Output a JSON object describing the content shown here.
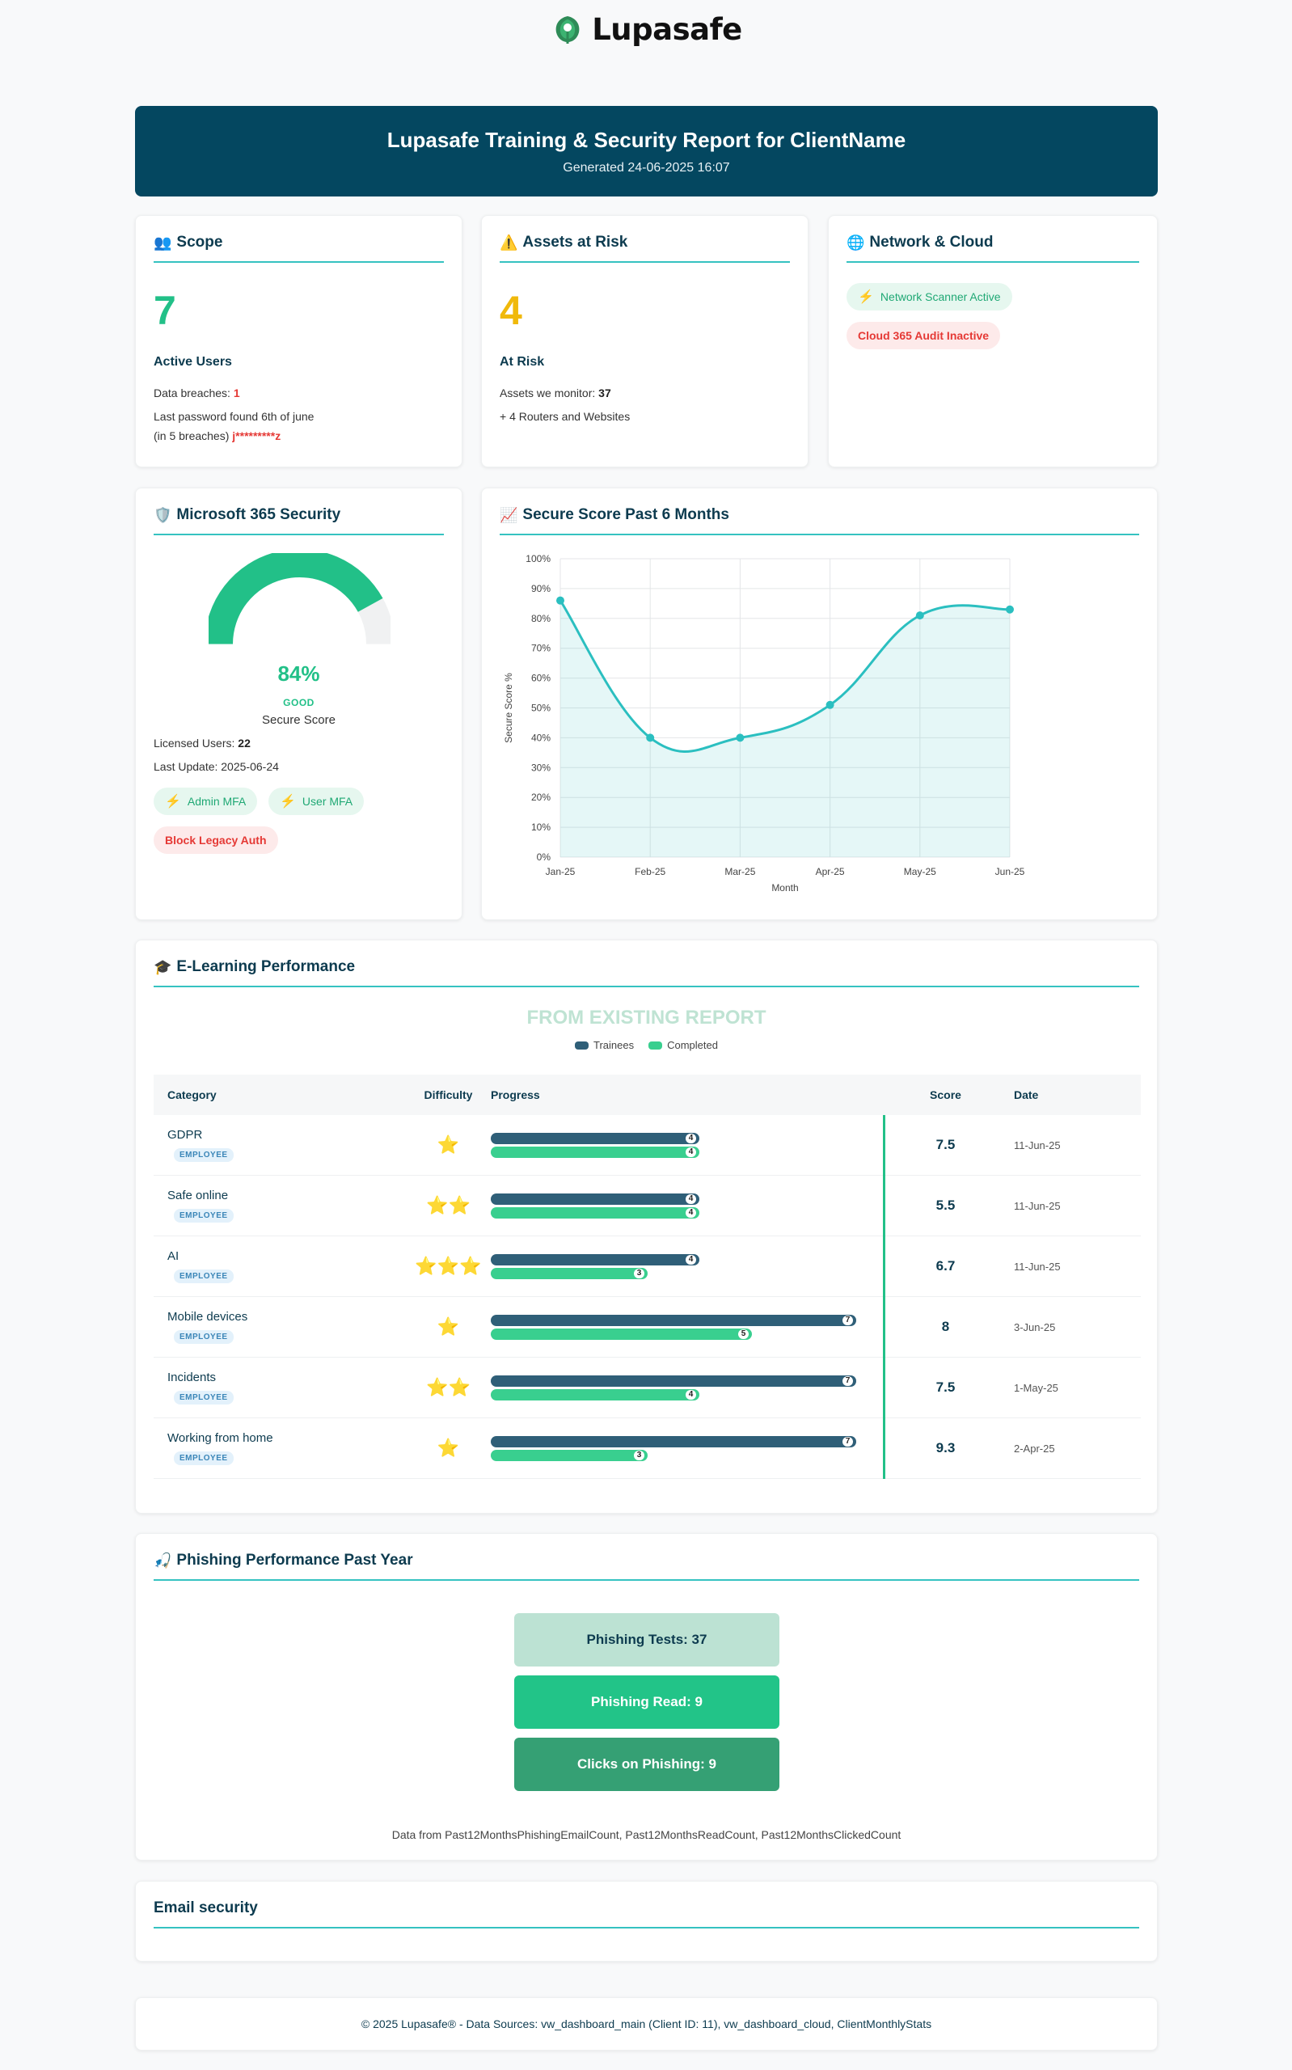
{
  "brand": {
    "name": "Lupasafe"
  },
  "header": {
    "title": "Lupasafe Training & Security Report for ClientName",
    "generated": "Generated 24-06-2025 16:07"
  },
  "scope": {
    "icon": "👥",
    "title": "Scope",
    "count": "7",
    "label": "Active Users",
    "breaches_label": "Data breaches: ",
    "breaches_value": "1",
    "last_password": "Last password found 6th of june",
    "breach_count_text": "(in 5 breaches) ",
    "masked_password": "j*********z"
  },
  "assets": {
    "icon": "⚠️",
    "title": "Assets at Risk",
    "count": "4",
    "label": "At Risk",
    "monitor_label": "Assets we monitor: ",
    "monitor_value": "37",
    "extra": "+ 4 Routers and Websites"
  },
  "network": {
    "icon": "🌐",
    "title": "Network & Cloud",
    "scanner": "Network Scanner Active",
    "cloud": "Cloud 365 Audit Inactive"
  },
  "m365": {
    "icon": "🛡️",
    "title": "Microsoft 365 Security",
    "score_pct": "84%",
    "score_value": 0.84,
    "rating": "GOOD",
    "score_label": "Secure Score",
    "licensed_label": "Licensed Users: ",
    "licensed_value": "22",
    "last_update": "Last Update: 2025-06-24",
    "admin_mfa": "Admin MFA",
    "user_mfa": "User MFA",
    "legacy": "Block Legacy Auth"
  },
  "secure_score": {
    "icon": "📈",
    "title": "Secure Score Past 6 Months"
  },
  "chart_data": {
    "type": "area",
    "categories": [
      "Jan-25",
      "Feb-25",
      "Mar-25",
      "Apr-25",
      "May-25",
      "Jun-25"
    ],
    "values": [
      86,
      40,
      40,
      51,
      81,
      83
    ],
    "xlabel": "Month",
    "ylabel": "Secure Score %",
    "ylim": [
      0,
      100
    ],
    "y_ticks": [
      "0%",
      "10%",
      "20%",
      "30%",
      "40%",
      "50%",
      "60%",
      "70%",
      "80%",
      "90%",
      "100%"
    ],
    "grid": true,
    "color": "#2bbfc0"
  },
  "elearning": {
    "icon": "🎓",
    "title": "E-Learning Performance",
    "watermark": "FROM EXISTING REPORT",
    "legend_trainees": "Trainees",
    "legend_completed": "Completed",
    "columns": [
      "Category",
      "Difficulty",
      "Progress",
      "Score",
      "Date"
    ],
    "max_trainees": 7,
    "rows": [
      {
        "category": "GDPR",
        "badge": "EMPLOYEE",
        "stars": "⭐",
        "trainees": 4,
        "completed": 4,
        "score": "7.5",
        "date": "11-Jun-25"
      },
      {
        "category": "Safe online",
        "badge": "EMPLOYEE",
        "stars": "⭐⭐",
        "trainees": 4,
        "completed": 4,
        "score": "5.5",
        "date": "11-Jun-25"
      },
      {
        "category": "AI",
        "badge": "EMPLOYEE",
        "stars": "⭐⭐⭐",
        "trainees": 4,
        "completed": 3,
        "score": "6.7",
        "date": "11-Jun-25"
      },
      {
        "category": "Mobile devices",
        "badge": "EMPLOYEE",
        "stars": "⭐",
        "trainees": 7,
        "completed": 5,
        "score": "8",
        "date": "3-Jun-25"
      },
      {
        "category": "Incidents",
        "badge": "EMPLOYEE",
        "stars": "⭐⭐",
        "trainees": 7,
        "completed": 4,
        "score": "7.5",
        "date": "1-May-25"
      },
      {
        "category": "Working from home",
        "badge": "EMPLOYEE",
        "stars": "⭐",
        "trainees": 7,
        "completed": 3,
        "score": "9.3",
        "date": "2-Apr-25"
      }
    ]
  },
  "phishing": {
    "icon": "🎣",
    "title": "Phishing Performance Past Year",
    "tests": "Phishing Tests: 37",
    "read": "Phishing Read: 9",
    "clicks": "Clicks on Phishing: 9",
    "source": "Data from Past12MonthsPhishingEmailCount, Past12MonthsReadCount, Past12MonthsClickedCount"
  },
  "email_security": {
    "title": "Email security"
  },
  "footer": {
    "text": "© 2025 Lupasafe® - Data Sources: vw_dashboard_main (Client ID: 11), vw_dashboard_cloud, ClientMonthlyStats"
  }
}
